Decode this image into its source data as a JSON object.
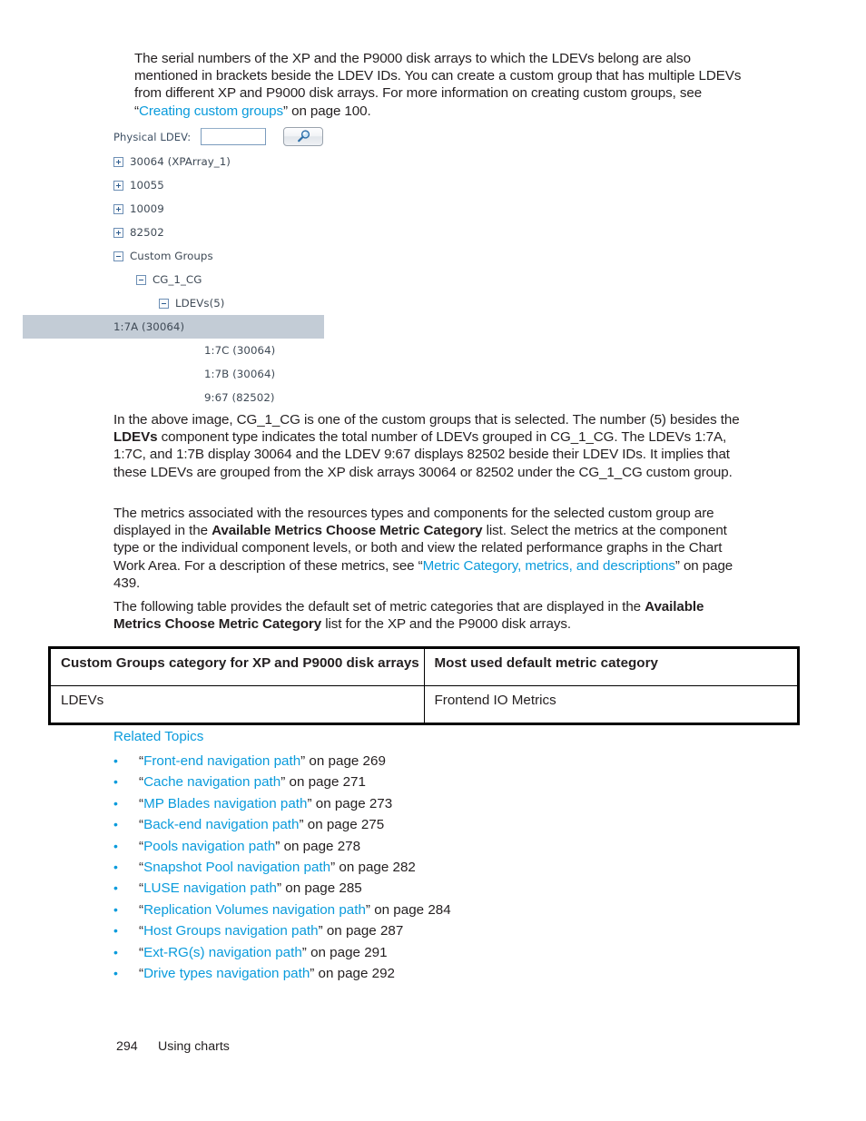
{
  "document": {
    "paragraphs": {
      "intro": {
        "line1": "The serial numbers of the XP and the P9000 disk arrays to which the LDEVs belong are also",
        "line2": "mentioned in brackets beside the LDEV IDs. You can create a custom group that has multiple LDEVs",
        "line3_pre": "from different XP and P9000 disk arrays. For more information on creating custom groups, see",
        "link": "Creating custom groups",
        "link_suffix": "” on page 100.",
        "quote_open": "“"
      },
      "explanation": {
        "seg1": "In the above image, CG_1_CG is one of the custom groups that is selected. The number (5) besides the ",
        "bold1": "LDEVs",
        "seg2": " component type indicates the total number of LDEVs grouped in CG_1_CG. The LDEVs 1:7A, 1:7C, and 1:7B display 30064 and the LDEV 9:67 displays 82502 beside their LDEV IDs. It implies that these LDEVs are grouped from the XP disk arrays 30064 or 82502 under the CG_1_CG custom group."
      },
      "metrics": {
        "seg1": "The metrics associated with the resources types and components for the selected custom group are displayed in the ",
        "bold1": "Available Metrics Choose Metric Category",
        "seg2": " list. Select the metrics at the component type or the individual component levels, or both and view the related performance graphs in the Chart Work Area. For a description of these metrics, see “",
        "link": "Metric Category, metrics, and descriptions",
        "seg3": "” on page 439."
      },
      "table_intro": {
        "seg1": "The following table provides the default set of metric categories that are displayed in the ",
        "bold1": "Available Metrics Choose Metric Category",
        "seg2": " list for the XP and the P9000 disk arrays."
      }
    },
    "screenshot_widget": {
      "field_label": "Physical LDEV:",
      "field_value": "",
      "field_placeholder": "",
      "search_button_icon": "magnifier-icon",
      "tree": [
        {
          "label": "30064 (XPArray_1)",
          "state": "collapsed",
          "depth": 0,
          "selected": false
        },
        {
          "label": "10055",
          "state": "collapsed",
          "depth": 0,
          "selected": false
        },
        {
          "label": "10009",
          "state": "collapsed",
          "depth": 0,
          "selected": false
        },
        {
          "label": "82502",
          "state": "collapsed",
          "depth": 0,
          "selected": false
        },
        {
          "label": "Custom Groups",
          "state": "expanded",
          "depth": 0,
          "selected": false
        },
        {
          "label": "CG_1_CG",
          "state": "expanded",
          "depth": 1,
          "selected": false
        },
        {
          "label": "LDEVs(5)",
          "state": "expanded",
          "depth": 2,
          "selected": false
        },
        {
          "label": "1:7A (30064)",
          "state": "leaf",
          "depth": 3,
          "selected": true
        },
        {
          "label": "1:7C (30064)",
          "state": "leaf",
          "depth": 3,
          "selected": false
        },
        {
          "label": "1:7B (30064)",
          "state": "leaf",
          "depth": 3,
          "selected": false
        },
        {
          "label": "9:67 (82502)",
          "state": "leaf",
          "depth": 3,
          "selected": false
        }
      ]
    },
    "table": {
      "headers": [
        "Custom Groups category for XP and P9000 disk arrays",
        "Most used default metric category"
      ],
      "rows": [
        [
          "LDEVs",
          "Frontend IO Metrics"
        ]
      ]
    },
    "related_topics": {
      "title": "Related Topics",
      "bullet": "•",
      "items": [
        {
          "link": "Front-end navigation path",
          "suffix": "” on page 269"
        },
        {
          "link": "Cache navigation path",
          "suffix": "” on page 271"
        },
        {
          "link": "MP Blades navigation path",
          "suffix": "” on page 273"
        },
        {
          "link": "Back-end navigation path",
          "suffix": "” on page 275"
        },
        {
          "link": "Pools navigation path",
          "suffix": "” on page 278"
        },
        {
          "link": "Snapshot Pool navigation path",
          "suffix": "” on page 282"
        },
        {
          "link": "LUSE navigation path",
          "suffix": "” on page 285"
        },
        {
          "link": "Replication Volumes navigation path",
          "suffix": "” on page 284"
        },
        {
          "link": "Host Groups navigation path",
          "suffix": "” on page 287"
        },
        {
          "link": "Ext-RG(s) navigation path",
          "suffix": "” on page 291"
        },
        {
          "link": "Drive types navigation path",
          "suffix": "” on page 292"
        }
      ]
    },
    "footer": {
      "page_number": "294",
      "section": "Using charts"
    },
    "colors": {
      "link": "#0a9bdc",
      "text": "#231f20",
      "selection": "#c3ccd6",
      "tree_text": "#3f4a56"
    }
  }
}
